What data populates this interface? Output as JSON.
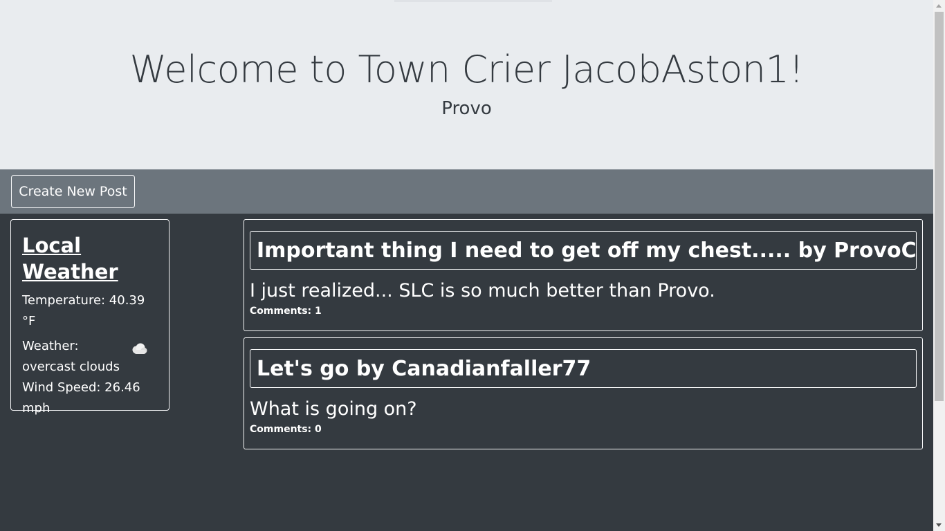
{
  "header": {
    "title": "Welcome to Town Crier JacobAston1!",
    "city": "Provo"
  },
  "toolbar": {
    "create_label": "Create New Post"
  },
  "weather": {
    "heading_line1": "Local",
    "heading_line2": "Weather",
    "temperature": "Temperature: 40.39 °F",
    "condition": "Weather: overcast clouds",
    "wind": "Wind Speed: 26.46 mph",
    "icon": "cloud-icon"
  },
  "posts": [
    {
      "title": "Important thing I need to get off my chest..... by ProvoChad",
      "body": "I just realized... SLC is so much better than Provo.",
      "comments": "Comments: 1"
    },
    {
      "title": "Let's go by Canadianfaller77",
      "body": "What is going on?",
      "comments": "Comments: 0"
    }
  ],
  "colors": {
    "hero_bg": "#e9ecef",
    "toolbar_bg": "#6c757d",
    "page_bg": "#343a40",
    "border": "#f8f9fa"
  }
}
